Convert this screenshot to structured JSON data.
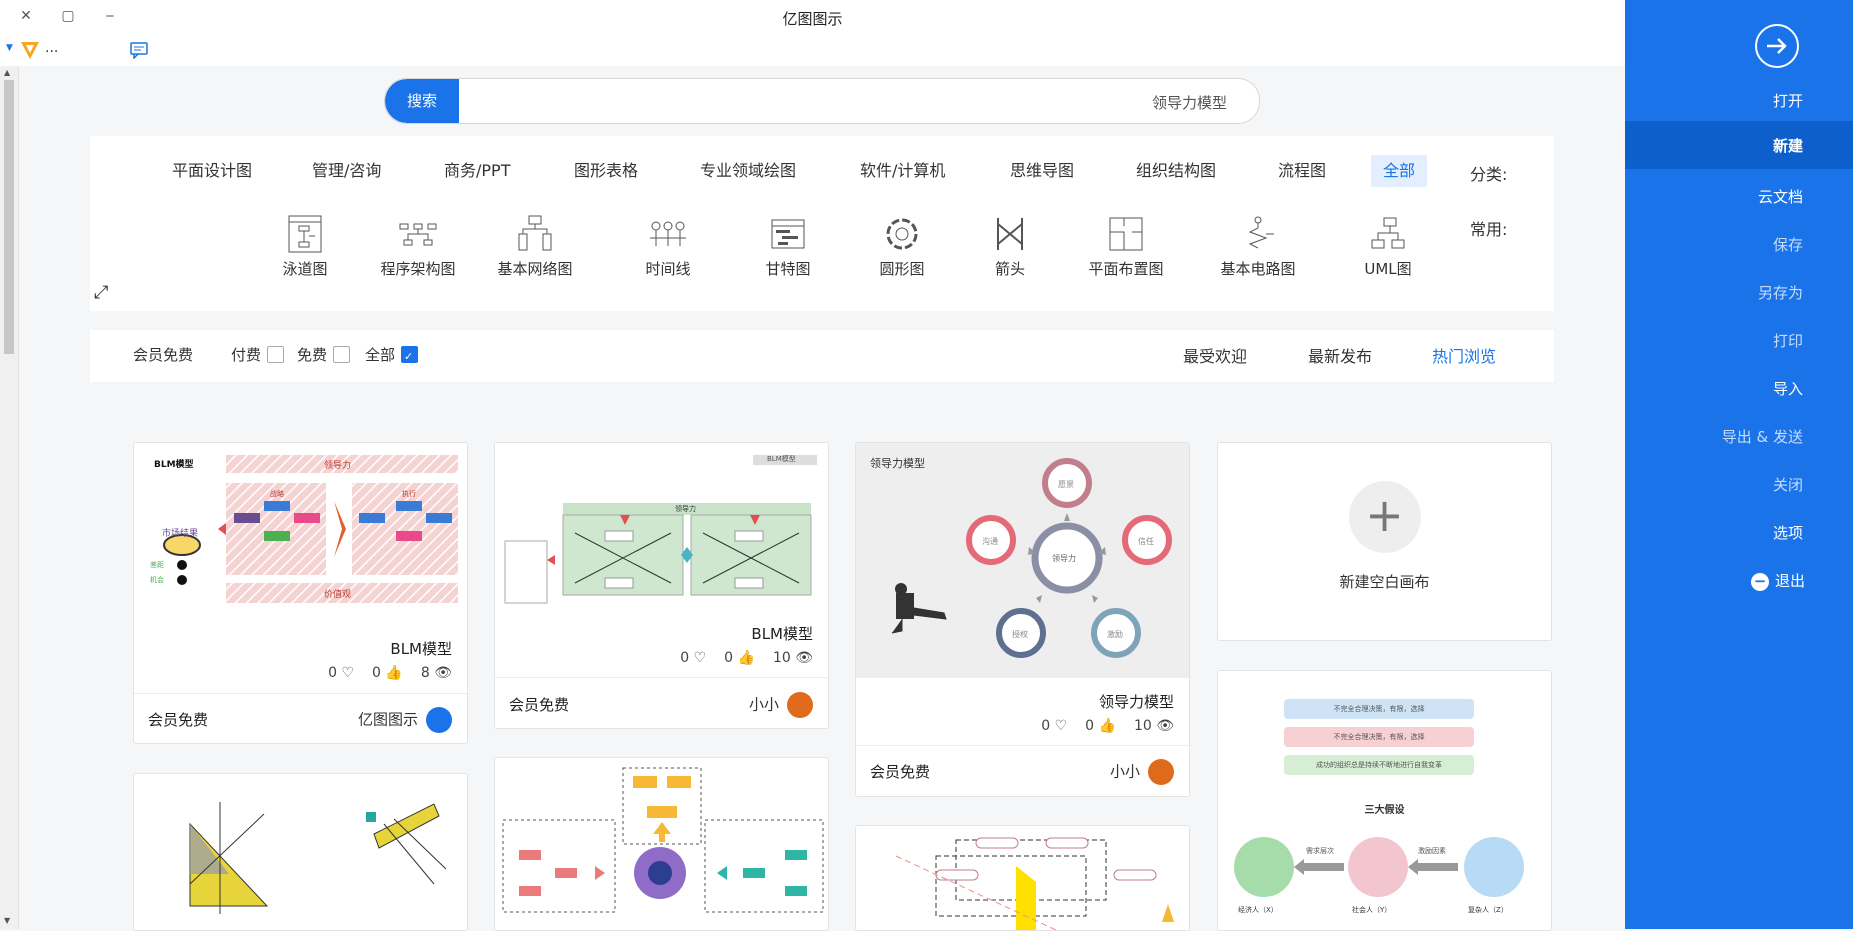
{
  "window": {
    "title": "亿图图示",
    "close": "✕",
    "restore": "▢",
    "minimize": "‒"
  },
  "toolbar": {
    "ellipsis": "..."
  },
  "search": {
    "button": "搜索",
    "value": "领导力模型"
  },
  "categories": {
    "head": "分类:",
    "items": [
      "全部",
      "流程图",
      "组织结构图",
      "思维导图",
      "软件/计算机",
      "专业领域绘图",
      "图形表格",
      "商务/PPT",
      "管理/咨询",
      "平面设计图"
    ]
  },
  "common": {
    "head": "常用:",
    "items": [
      "UML图",
      "基本电路图",
      "平面布置图",
      "箭头",
      "圆形图",
      "甘特图",
      "时间线",
      "基本网络图",
      "程序架构图",
      "泳道图"
    ]
  },
  "filters": {
    "tabs": [
      "热门浏览",
      "最新发布",
      "最受欢迎"
    ],
    "checks": [
      "全部",
      "免费",
      "付费",
      "会员免费"
    ]
  },
  "cards": {
    "new_blank": "新建空白画布",
    "c1": {
      "name": "领导力模型",
      "views": "10",
      "likes": "0",
      "favs": "0",
      "author": "小小",
      "price": "会员免费",
      "thumb_label": "领导力模型",
      "nodes": [
        "领导力",
        "愿景",
        "沟通",
        "信任",
        "授权",
        "激励"
      ]
    },
    "c2": {
      "name": "BLM模型",
      "views": "10",
      "likes": "0",
      "favs": "0",
      "author": "小小",
      "price": "会员免费",
      "thumb_label": "BLM模型",
      "thumb_head": "领导力"
    },
    "c3": {
      "name": "BLM模型",
      "views": "8",
      "likes": "0",
      "favs": "0",
      "author": "亿图图示",
      "price": "会员免费",
      "thumb_label": "BLM模型",
      "thumb_top": "领导力",
      "thumb_bottom": "价值观",
      "thumb_side": "市场结果",
      "thumb_box1": "战略",
      "thumb_box2": "执行",
      "thumb_legend1": "差距",
      "thumb_legend2": "机会"
    },
    "c4": {
      "title": "三大假设",
      "bars": [
        "不完全合理决策，有限，选择",
        "不完全合理决策，有限，选择",
        "成功的组织总是持续不断地进行自我变革"
      ],
      "circles": [
        "经济人（X）",
        "社会人（Y）",
        "复杂人（Z）"
      ],
      "arrows": [
        "需求层次",
        "激励因素"
      ]
    }
  },
  "sidebar": {
    "items": [
      "打开",
      "新建",
      "云文档",
      "保存",
      "另存为",
      "打印",
      "导入",
      "导出 & 发送",
      "关闭",
      "选项",
      "退出"
    ]
  },
  "colors": {
    "accent": "#1a73e8",
    "sidebar": "#1a73e8",
    "sidebar_active": "#0d5fcc"
  }
}
